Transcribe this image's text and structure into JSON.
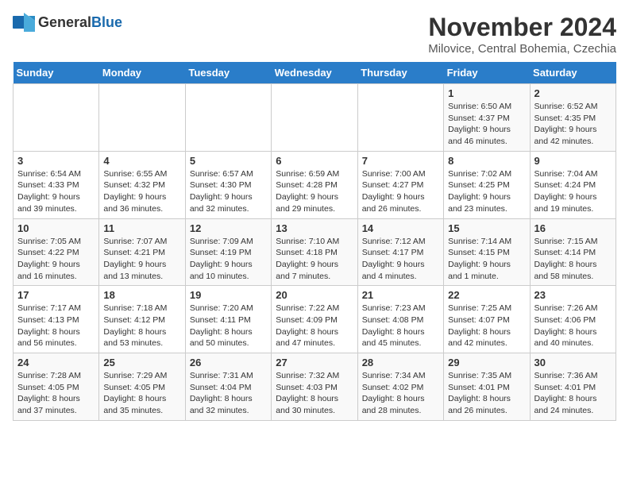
{
  "header": {
    "logo_general": "General",
    "logo_blue": "Blue",
    "month_title": "November 2024",
    "location": "Milovice, Central Bohemia, Czechia"
  },
  "weekdays": [
    "Sunday",
    "Monday",
    "Tuesday",
    "Wednesday",
    "Thursday",
    "Friday",
    "Saturday"
  ],
  "weeks": [
    [
      {
        "day": "",
        "info": ""
      },
      {
        "day": "",
        "info": ""
      },
      {
        "day": "",
        "info": ""
      },
      {
        "day": "",
        "info": ""
      },
      {
        "day": "",
        "info": ""
      },
      {
        "day": "1",
        "info": "Sunrise: 6:50 AM\nSunset: 4:37 PM\nDaylight: 9 hours\nand 46 minutes."
      },
      {
        "day": "2",
        "info": "Sunrise: 6:52 AM\nSunset: 4:35 PM\nDaylight: 9 hours\nand 42 minutes."
      }
    ],
    [
      {
        "day": "3",
        "info": "Sunrise: 6:54 AM\nSunset: 4:33 PM\nDaylight: 9 hours\nand 39 minutes."
      },
      {
        "day": "4",
        "info": "Sunrise: 6:55 AM\nSunset: 4:32 PM\nDaylight: 9 hours\nand 36 minutes."
      },
      {
        "day": "5",
        "info": "Sunrise: 6:57 AM\nSunset: 4:30 PM\nDaylight: 9 hours\nand 32 minutes."
      },
      {
        "day": "6",
        "info": "Sunrise: 6:59 AM\nSunset: 4:28 PM\nDaylight: 9 hours\nand 29 minutes."
      },
      {
        "day": "7",
        "info": "Sunrise: 7:00 AM\nSunset: 4:27 PM\nDaylight: 9 hours\nand 26 minutes."
      },
      {
        "day": "8",
        "info": "Sunrise: 7:02 AM\nSunset: 4:25 PM\nDaylight: 9 hours\nand 23 minutes."
      },
      {
        "day": "9",
        "info": "Sunrise: 7:04 AM\nSunset: 4:24 PM\nDaylight: 9 hours\nand 19 minutes."
      }
    ],
    [
      {
        "day": "10",
        "info": "Sunrise: 7:05 AM\nSunset: 4:22 PM\nDaylight: 9 hours\nand 16 minutes."
      },
      {
        "day": "11",
        "info": "Sunrise: 7:07 AM\nSunset: 4:21 PM\nDaylight: 9 hours\nand 13 minutes."
      },
      {
        "day": "12",
        "info": "Sunrise: 7:09 AM\nSunset: 4:19 PM\nDaylight: 9 hours\nand 10 minutes."
      },
      {
        "day": "13",
        "info": "Sunrise: 7:10 AM\nSunset: 4:18 PM\nDaylight: 9 hours\nand 7 minutes."
      },
      {
        "day": "14",
        "info": "Sunrise: 7:12 AM\nSunset: 4:17 PM\nDaylight: 9 hours\nand 4 minutes."
      },
      {
        "day": "15",
        "info": "Sunrise: 7:14 AM\nSunset: 4:15 PM\nDaylight: 9 hours\nand 1 minute."
      },
      {
        "day": "16",
        "info": "Sunrise: 7:15 AM\nSunset: 4:14 PM\nDaylight: 8 hours\nand 58 minutes."
      }
    ],
    [
      {
        "day": "17",
        "info": "Sunrise: 7:17 AM\nSunset: 4:13 PM\nDaylight: 8 hours\nand 56 minutes."
      },
      {
        "day": "18",
        "info": "Sunrise: 7:18 AM\nSunset: 4:12 PM\nDaylight: 8 hours\nand 53 minutes."
      },
      {
        "day": "19",
        "info": "Sunrise: 7:20 AM\nSunset: 4:11 PM\nDaylight: 8 hours\nand 50 minutes."
      },
      {
        "day": "20",
        "info": "Sunrise: 7:22 AM\nSunset: 4:09 PM\nDaylight: 8 hours\nand 47 minutes."
      },
      {
        "day": "21",
        "info": "Sunrise: 7:23 AM\nSunset: 4:08 PM\nDaylight: 8 hours\nand 45 minutes."
      },
      {
        "day": "22",
        "info": "Sunrise: 7:25 AM\nSunset: 4:07 PM\nDaylight: 8 hours\nand 42 minutes."
      },
      {
        "day": "23",
        "info": "Sunrise: 7:26 AM\nSunset: 4:06 PM\nDaylight: 8 hours\nand 40 minutes."
      }
    ],
    [
      {
        "day": "24",
        "info": "Sunrise: 7:28 AM\nSunset: 4:05 PM\nDaylight: 8 hours\nand 37 minutes."
      },
      {
        "day": "25",
        "info": "Sunrise: 7:29 AM\nSunset: 4:05 PM\nDaylight: 8 hours\nand 35 minutes."
      },
      {
        "day": "26",
        "info": "Sunrise: 7:31 AM\nSunset: 4:04 PM\nDaylight: 8 hours\nand 32 minutes."
      },
      {
        "day": "27",
        "info": "Sunrise: 7:32 AM\nSunset: 4:03 PM\nDaylight: 8 hours\nand 30 minutes."
      },
      {
        "day": "28",
        "info": "Sunrise: 7:34 AM\nSunset: 4:02 PM\nDaylight: 8 hours\nand 28 minutes."
      },
      {
        "day": "29",
        "info": "Sunrise: 7:35 AM\nSunset: 4:01 PM\nDaylight: 8 hours\nand 26 minutes."
      },
      {
        "day": "30",
        "info": "Sunrise: 7:36 AM\nSunset: 4:01 PM\nDaylight: 8 hours\nand 24 minutes."
      }
    ]
  ]
}
